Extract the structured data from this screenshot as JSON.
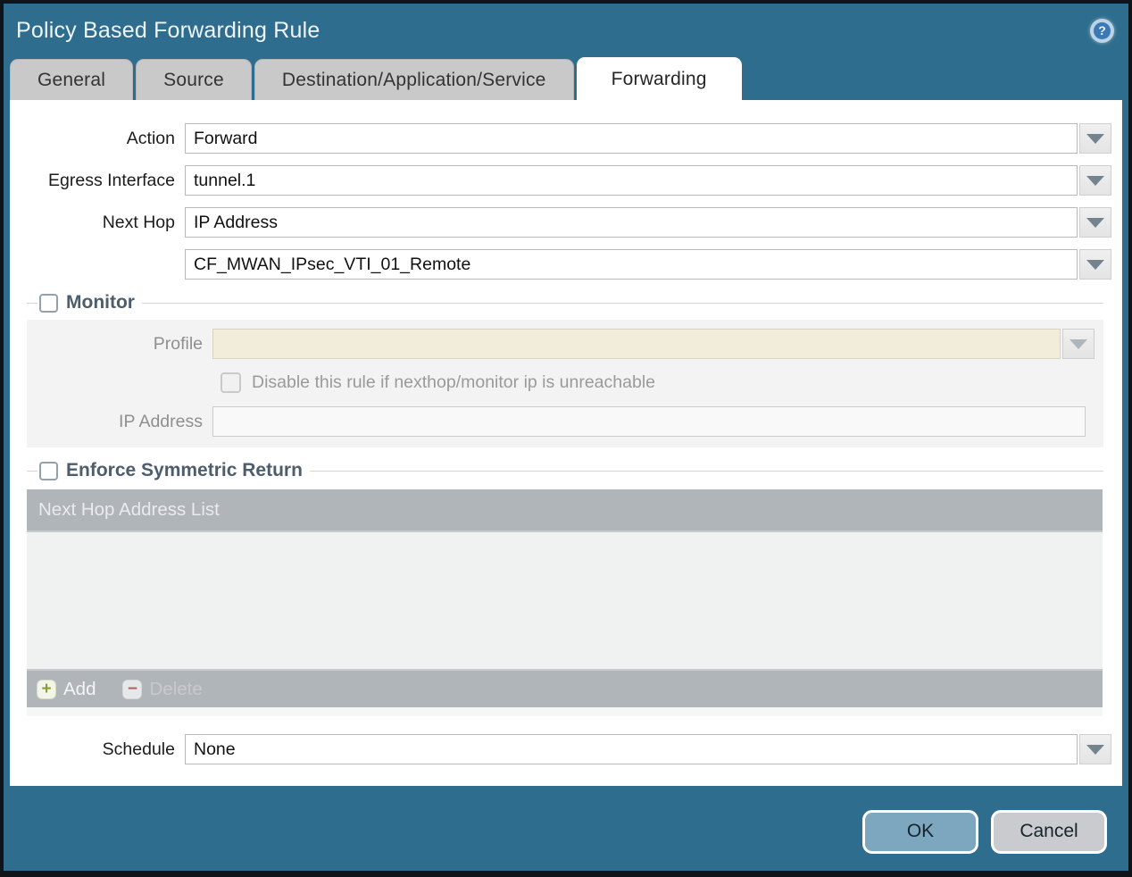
{
  "window": {
    "title": "Policy Based Forwarding Rule"
  },
  "tabs": [
    {
      "label": "General",
      "active": false
    },
    {
      "label": "Source",
      "active": false
    },
    {
      "label": "Destination/Application/Service",
      "active": false
    },
    {
      "label": "Forwarding",
      "active": true
    }
  ],
  "form": {
    "action": {
      "label": "Action",
      "value": "Forward"
    },
    "egress_interface": {
      "label": "Egress Interface",
      "value": "tunnel.1"
    },
    "next_hop": {
      "label": "Next Hop",
      "value": "IP Address"
    },
    "next_hop_address": {
      "value": "CF_MWAN_IPsec_VTI_01_Remote"
    },
    "schedule": {
      "label": "Schedule",
      "value": "None"
    }
  },
  "monitor": {
    "title": "Monitor",
    "checked": false,
    "profile": {
      "label": "Profile",
      "value": ""
    },
    "disable_rule": {
      "label": "Disable this rule if nexthop/monitor ip is unreachable",
      "checked": false
    },
    "ip_address": {
      "label": "IP Address",
      "value": ""
    }
  },
  "symmetric_return": {
    "title": "Enforce Symmetric Return",
    "checked": false,
    "table": {
      "header": "Next Hop Address List",
      "rows": []
    },
    "add_label": "Add",
    "delete_label": "Delete"
  },
  "footer": {
    "ok_label": "OK",
    "cancel_label": "Cancel"
  },
  "icons": {
    "help": "?",
    "add": "+",
    "delete": "−"
  },
  "colors": {
    "titlebar_teal": "#2e6d8d",
    "tab_inactive": "#c9c9c9",
    "tab_active": "#ffffff",
    "group_title": "#4d5d6b",
    "disabled_field_beige": "#f1edda",
    "table_chrome_gray": "#b0b5ba",
    "ok_button": "#7da7bf",
    "cancel_button": "#c9cbce",
    "add_plus_green": "#85a032",
    "delete_minus_red": "#a8695a"
  }
}
